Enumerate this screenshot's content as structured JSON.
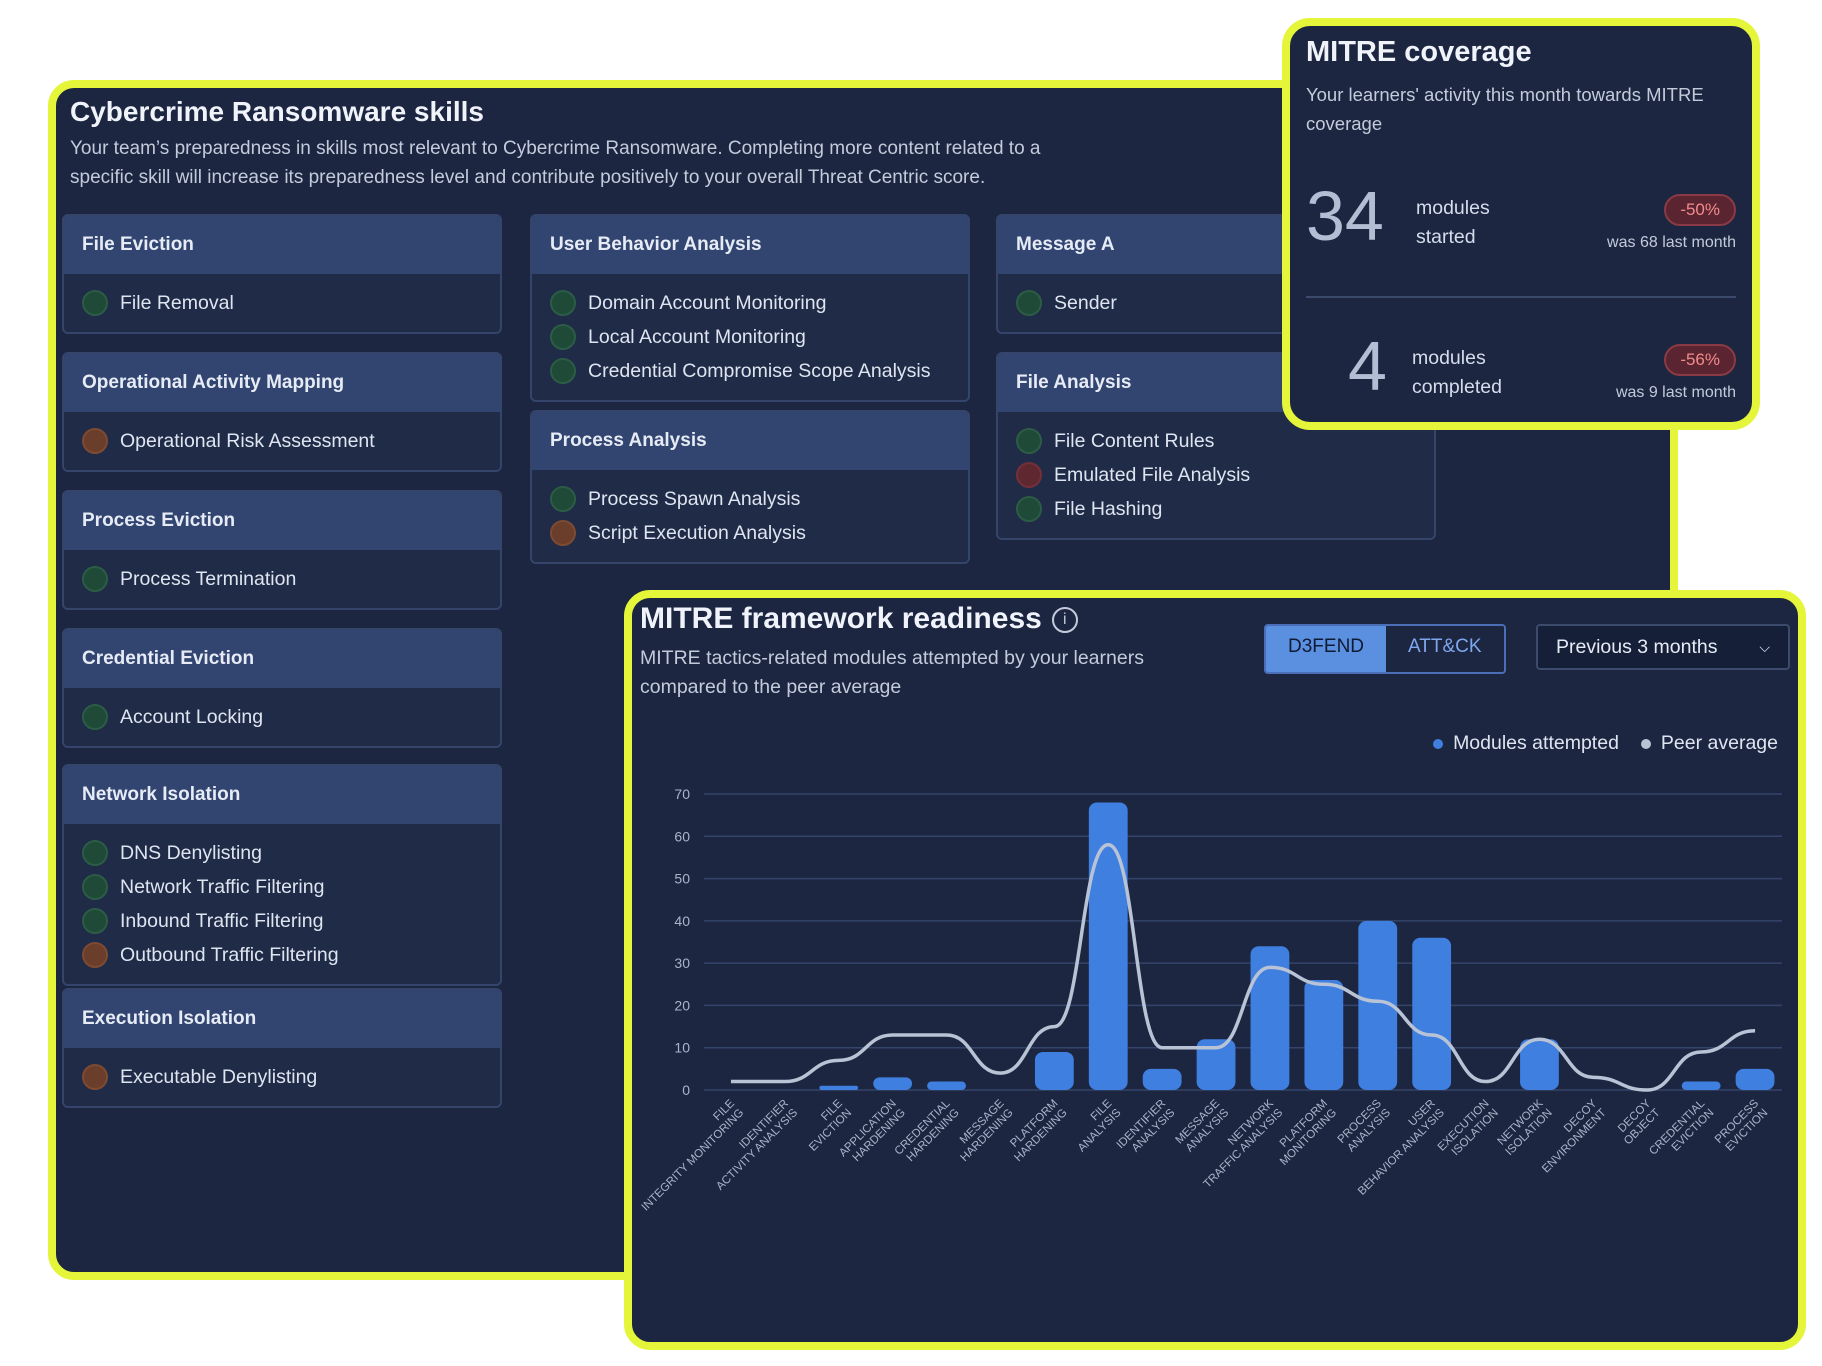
{
  "skills_panel": {
    "title": "Cybercrime Ransomware skills",
    "description": "Your team’s preparedness in skills most relevant to Cybercrime Ransomware. Completing more content related to a specific skill will increase its preparedness level and contribute positively to your overall Threat Centric score.",
    "cards": [
      {
        "title": "File Eviction",
        "skills": [
          {
            "label": "File Removal",
            "status": "green"
          }
        ]
      },
      {
        "title": "Operational Activity Mapping",
        "skills": [
          {
            "label": "Operational Risk Assessment",
            "status": "orange"
          }
        ]
      },
      {
        "title": "Process Eviction",
        "skills": [
          {
            "label": "Process Termination",
            "status": "green"
          }
        ]
      },
      {
        "title": "Credential Eviction",
        "skills": [
          {
            "label": "Account Locking",
            "status": "green"
          }
        ]
      },
      {
        "title": "Network Isolation",
        "skills": [
          {
            "label": "DNS Denylisting",
            "status": "green"
          },
          {
            "label": "Network Traffic Filtering",
            "status": "green"
          },
          {
            "label": "Inbound Traffic Filtering",
            "status": "green"
          },
          {
            "label": "Outbound Traffic Filtering",
            "status": "orange"
          }
        ]
      },
      {
        "title": "Execution Isolation",
        "skills": [
          {
            "label": "Executable Denylisting",
            "status": "orange"
          }
        ]
      },
      {
        "title": "User Behavior Analysis",
        "skills": [
          {
            "label": "Domain Account Monitoring",
            "status": "green"
          },
          {
            "label": "Local Account Monitoring",
            "status": "green"
          },
          {
            "label": "Credential Compromise Scope Analysis",
            "status": "green"
          }
        ]
      },
      {
        "title": "Process Analysis",
        "skills": [
          {
            "label": "Process Spawn Analysis",
            "status": "green"
          },
          {
            "label": "Script Execution Analysis",
            "status": "orange"
          }
        ]
      },
      {
        "title": "Message A",
        "skills": [
          {
            "label": "Sender",
            "status": "green"
          }
        ]
      },
      {
        "title": "File Analysis",
        "skills": [
          {
            "label": "File Content Rules",
            "status": "green"
          },
          {
            "label": "Emulated File Analysis",
            "status": "red"
          },
          {
            "label": "File Hashing",
            "status": "green"
          }
        ]
      }
    ]
  },
  "coverage": {
    "title": "MITRE coverage",
    "description": "Your learners' activity this month towards MITRE coverage",
    "started": {
      "value": "34",
      "label_line1": "modules",
      "label_line2": "started",
      "change": "-50%",
      "was": "was 68 last month"
    },
    "completed": {
      "value": "4",
      "label_line1": "modules",
      "label_line2": "completed",
      "change": "-56%",
      "was": "was 9 last month"
    }
  },
  "readiness": {
    "title": "MITRE framework readiness",
    "info_icon": "info-icon",
    "description": "MITRE tactics-related modules attempted by your learners compared to the peer average",
    "tabs": [
      "D3FEND",
      "ATT&CK"
    ],
    "active_tab": "D3FEND",
    "period": "Previous 3 months",
    "colors": {
      "bar": "#3f7fe0",
      "line": "#b9c3d6",
      "grid": "#34446a"
    }
  },
  "chart_data": {
    "type": "bar",
    "categories": [
      [
        "FILE",
        "INTEGRITY MONITORING"
      ],
      [
        "IDENTIFIER",
        "ACTIVITY ANALYSIS"
      ],
      [
        "FILE",
        "EVICTION"
      ],
      [
        "APPLICATION",
        "HARDENING"
      ],
      [
        "CREDENTIAL",
        "HARDENING"
      ],
      [
        "MESSAGE",
        "HARDENING"
      ],
      [
        "PLATFORM",
        "HARDENING"
      ],
      [
        "FILE",
        "ANALYSIS"
      ],
      [
        "IDENTIFIER",
        "ANALYSIS"
      ],
      [
        "MESSAGE",
        "ANALYSIS"
      ],
      [
        "NETWORK",
        "TRAFFIC ANALYSIS"
      ],
      [
        "PLATFORM",
        "MONITORING"
      ],
      [
        "PROCESS",
        "ANALYSIS"
      ],
      [
        "USER",
        "BEHAVIOR ANALYSIS"
      ],
      [
        "EXECUTION",
        "ISOLATION"
      ],
      [
        "NETWORK",
        "ISOLATION"
      ],
      [
        "DECOY",
        "ENVIRONMENT"
      ],
      [
        "DECOY",
        "OBJECT"
      ],
      [
        "CREDENTIAL",
        "EVICTION"
      ],
      [
        "PROCESS",
        "EVICTION"
      ]
    ],
    "series": [
      {
        "name": "Modules attempted",
        "kind": "bar",
        "color": "#3f7fe0",
        "values": [
          0,
          0,
          1,
          3,
          2,
          0,
          9,
          68,
          5,
          12,
          34,
          26,
          40,
          36,
          0,
          12,
          0,
          0,
          2,
          5
        ]
      },
      {
        "name": "Peer average",
        "kind": "line",
        "color": "#b9c3d6",
        "values": [
          2,
          2,
          7,
          13,
          13,
          4,
          15,
          58,
          10,
          10,
          29,
          25,
          21,
          13,
          2,
          12,
          3,
          0,
          9,
          14
        ]
      }
    ],
    "ylim": [
      0,
      70
    ],
    "yticks": [
      0,
      10,
      20,
      30,
      40,
      50,
      60,
      70
    ],
    "grid": true,
    "legend": "top-right"
  }
}
